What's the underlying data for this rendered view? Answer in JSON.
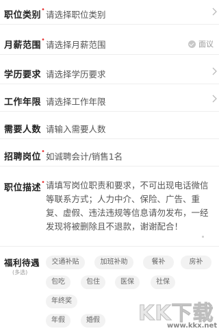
{
  "form": {
    "rows": [
      {
        "label": "职位类别",
        "required": true,
        "value": "请选择职位类别",
        "chevron": true
      },
      {
        "label": "月薪范围",
        "required": true,
        "value": "请选择月薪范围",
        "negotiable": "面议"
      },
      {
        "label": "学历要求",
        "required": false,
        "value": "请选择学历要求",
        "chevron": true
      },
      {
        "label": "工作年限",
        "required": false,
        "value": "请选择工作年限",
        "chevron": true
      },
      {
        "label": "需要人数",
        "required": false,
        "value": "请输入需要人数"
      },
      {
        "label": "招聘岗位",
        "required": true,
        "value": "如诚聘会计/销售1名"
      }
    ],
    "description": {
      "label": "职位描述",
      "required": true,
      "placeholder": "请填写岗位职责和要求，不可出现电话微信等联系方式；人力中介、保险、广告、重复、虚假、违法违规等信息请勿发布，一经发现将被删除且不退款，谢谢配合！"
    },
    "benefits": {
      "label": "福利待遇",
      "sublabel": "(多选)",
      "tags": [
        "交通补贴",
        "加班补助",
        "餐补",
        "房补",
        "包吃",
        "包住",
        "医保",
        "社保",
        "年终奖",
        "年假",
        "婚假"
      ]
    }
  },
  "watermark": {
    "text": "KK下载",
    "url": "www.kkx.net"
  },
  "colors": {
    "required_star": "#e63c3c",
    "tag_bg": "#f2f2f2",
    "divider": "#eeeeee"
  }
}
